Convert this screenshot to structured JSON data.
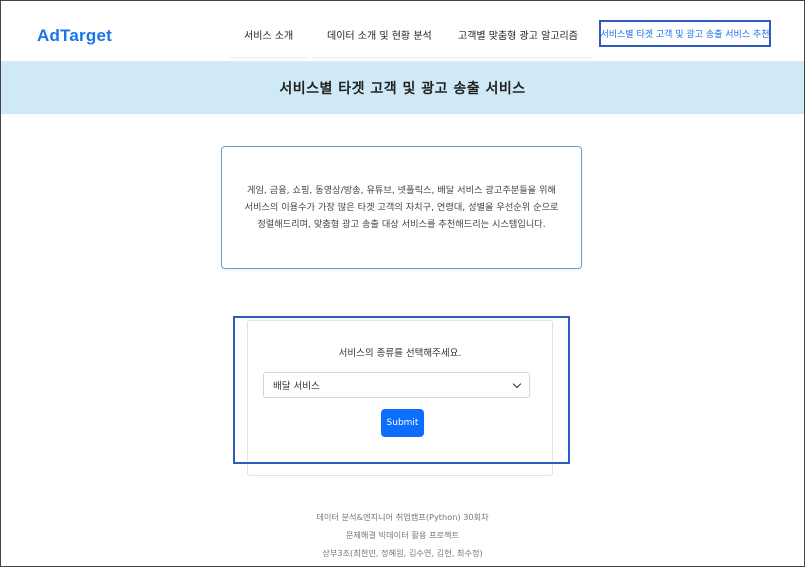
{
  "nav": {
    "brand": "AdTarget",
    "items": [
      {
        "label": "서비스 소개"
      },
      {
        "label": "데이터 소개 및 현황 분석"
      },
      {
        "label": "고객별 맞춤형 광고 알고리즘"
      },
      {
        "label": "서비스별 타겟 고객 및 광고 송출 서비스 추천"
      }
    ]
  },
  "hero": {
    "title": "서비스별 타겟 고객 및 광고 송출 서비스"
  },
  "intro": {
    "lines": [
      "게임, 금융, 쇼핑, 동영상/방송, 유튜브, 넷플릭스, 배달 서비스 광고주분들을 위해",
      "서비스의 이용수가 가장 많은 타겟 고객의 자치구, 연령대, 성별을 우선순위 순으로",
      "정렬해드리며, 맞춤형 광고 송출 대상 서비스를 추천해드리는 시스템입니다."
    ]
  },
  "form": {
    "label": "서비스의 종류를 선택해주세요.",
    "selected": "배달 서비스",
    "submit": "Submit"
  },
  "footer": {
    "lines": [
      "데이터 분석&엔지니어 취업캠프(Python) 30회차",
      "문제해결 빅데이터 활용 프로젝트",
      "상부3조(최현민, 정혜원, 김수연, 김현, 최수정)"
    ]
  },
  "colors": {
    "accent": "#1a73e8",
    "hero_bg": "#cfeaf6",
    "button": "#0d6efd",
    "highlight": "#2f5bbd"
  }
}
